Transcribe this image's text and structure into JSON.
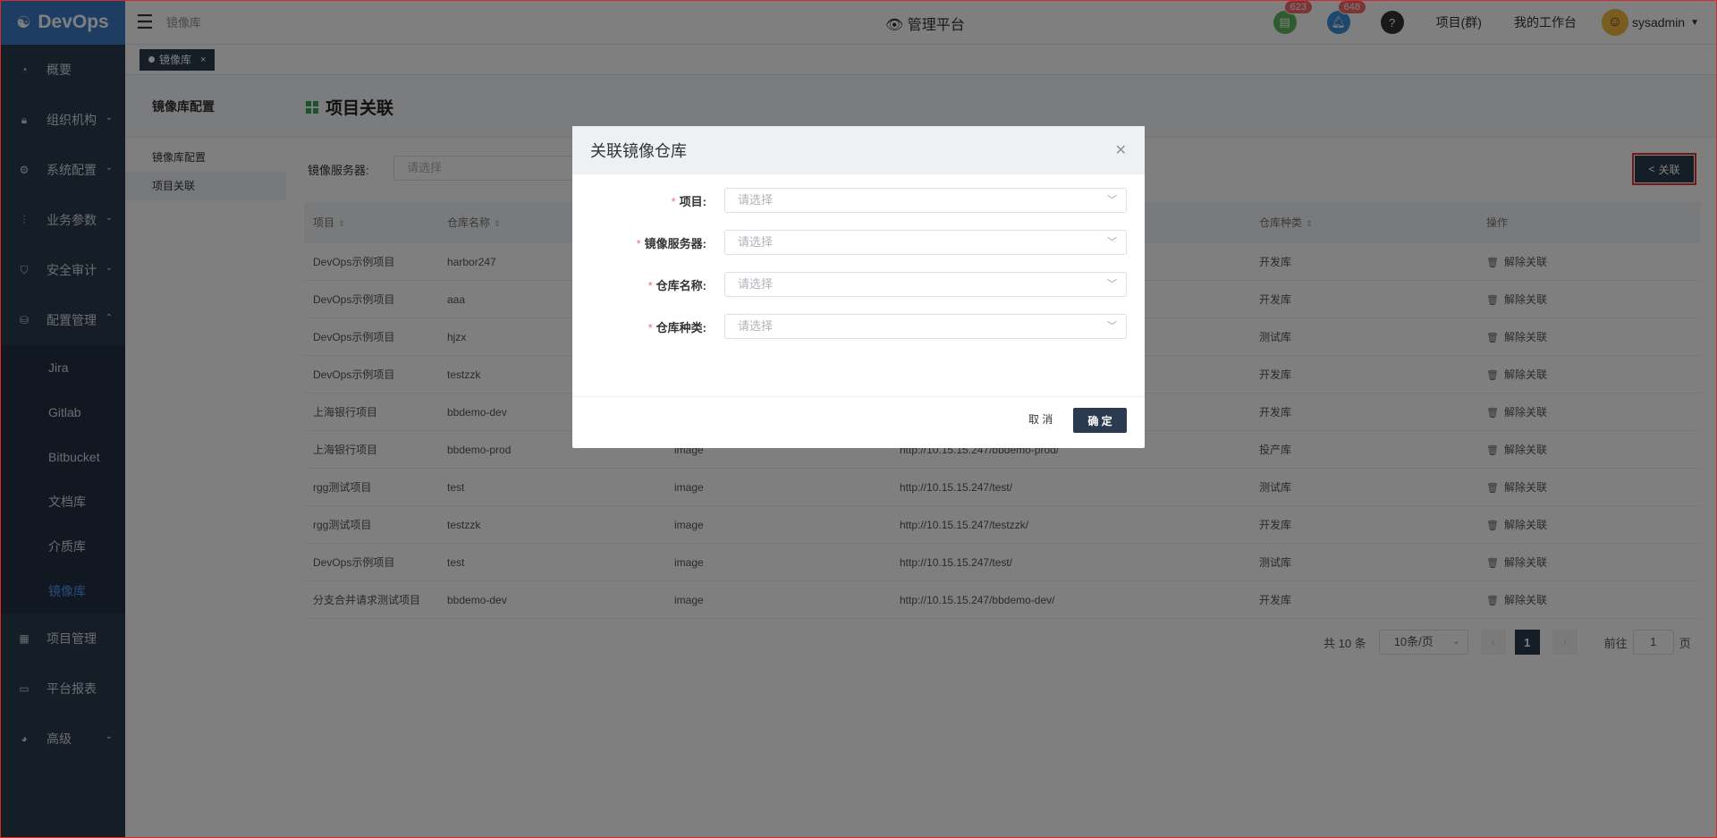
{
  "app": {
    "logo_text": "DevOps",
    "logo_mark": "☯"
  },
  "header": {
    "breadcrumb": "镜像库",
    "center_title": "管理平台",
    "badge_doc": "623",
    "badge_bell": "648",
    "link_project_group": "项目(群)",
    "link_workspace": "我的工作台",
    "username": "sysadmin"
  },
  "sidebar": {
    "items": [
      {
        "label": "概要",
        "icon": "dashboard-icon"
      },
      {
        "label": "组织机构",
        "icon": "lock-icon"
      },
      {
        "label": "系统配置",
        "icon": "gear-icon"
      },
      {
        "label": "业务参数",
        "icon": "sliders-icon"
      },
      {
        "label": "安全审计",
        "icon": "shield-icon"
      },
      {
        "label": "配置管理",
        "icon": "database-icon"
      }
    ],
    "sub_items": [
      "Jira",
      "Gitlab",
      "Bitbucket",
      "文档库",
      "介质库",
      "镜像库"
    ],
    "bottom_items": [
      {
        "label": "项目管理",
        "icon": "grid-icon"
      },
      {
        "label": "平台报表",
        "icon": "monitor-icon"
      },
      {
        "label": "高级",
        "icon": "palette-icon"
      }
    ]
  },
  "tabs": {
    "active": "镜像库"
  },
  "config_panel": {
    "title": "镜像库配置",
    "items": [
      "镜像库配置",
      "项目关联"
    ]
  },
  "main": {
    "title": "项目关联",
    "filter_label": "镜像服务器:",
    "filter_placeholder": "请选择",
    "link_button": "关联",
    "columns": [
      "项目",
      "仓库名称",
      "",
      "",
      "仓库种类",
      "操作"
    ],
    "rows": [
      [
        "DevOps示例项目",
        "harbor247",
        "",
        "",
        "开发库",
        "解除关联"
      ],
      [
        "DevOps示例项目",
        "aaa",
        "",
        "",
        "开发库",
        "解除关联"
      ],
      [
        "DevOps示例项目",
        "hjzx",
        "",
        "",
        "测试库",
        "解除关联"
      ],
      [
        "DevOps示例项目",
        "testzzk",
        "",
        "",
        "开发库",
        "解除关联"
      ],
      [
        "上海银行项目",
        "bbdemo-dev",
        "",
        "",
        "开发库",
        "解除关联"
      ],
      [
        "上海银行项目",
        "bbdemo-prod",
        "image",
        "http://10.15.15.247/bbdemo-prod/",
        "投产库",
        "解除关联"
      ],
      [
        "rgg测试项目",
        "test",
        "image",
        "http://10.15.15.247/test/",
        "测试库",
        "解除关联"
      ],
      [
        "rgg测试项目",
        "testzzk",
        "image",
        "http://10.15.15.247/testzzk/",
        "开发库",
        "解除关联"
      ],
      [
        "DevOps示例项目",
        "test",
        "image",
        "http://10.15.15.247/test/",
        "测试库",
        "解除关联"
      ],
      [
        "分支合并请求测试项目",
        "bbdemo-dev",
        "image",
        "http://10.15.15.247/bbdemo-dev/",
        "开发库",
        "解除关联"
      ]
    ],
    "pager": {
      "total": "共 10 条",
      "page_size": "10条/页",
      "current": "1",
      "goto_label": "前往",
      "goto_value": "1",
      "page_suffix": "页"
    }
  },
  "modal": {
    "title": "关联镜像仓库",
    "fields": [
      {
        "label": "项目:",
        "placeholder": "请选择"
      },
      {
        "label": "镜像服务器:",
        "placeholder": "请选择"
      },
      {
        "label": "仓库名称:",
        "placeholder": "请选择"
      },
      {
        "label": "仓库种类:",
        "placeholder": "请选择"
      }
    ],
    "cancel": "取 消",
    "confirm": "确 定"
  },
  "colors": {
    "sidebar": "#2b3a4e",
    "logo": "#3b7cc4",
    "active_sub": "#4b9bf0",
    "accent_green": "#3aa05a",
    "badge": "#f56c6c"
  }
}
